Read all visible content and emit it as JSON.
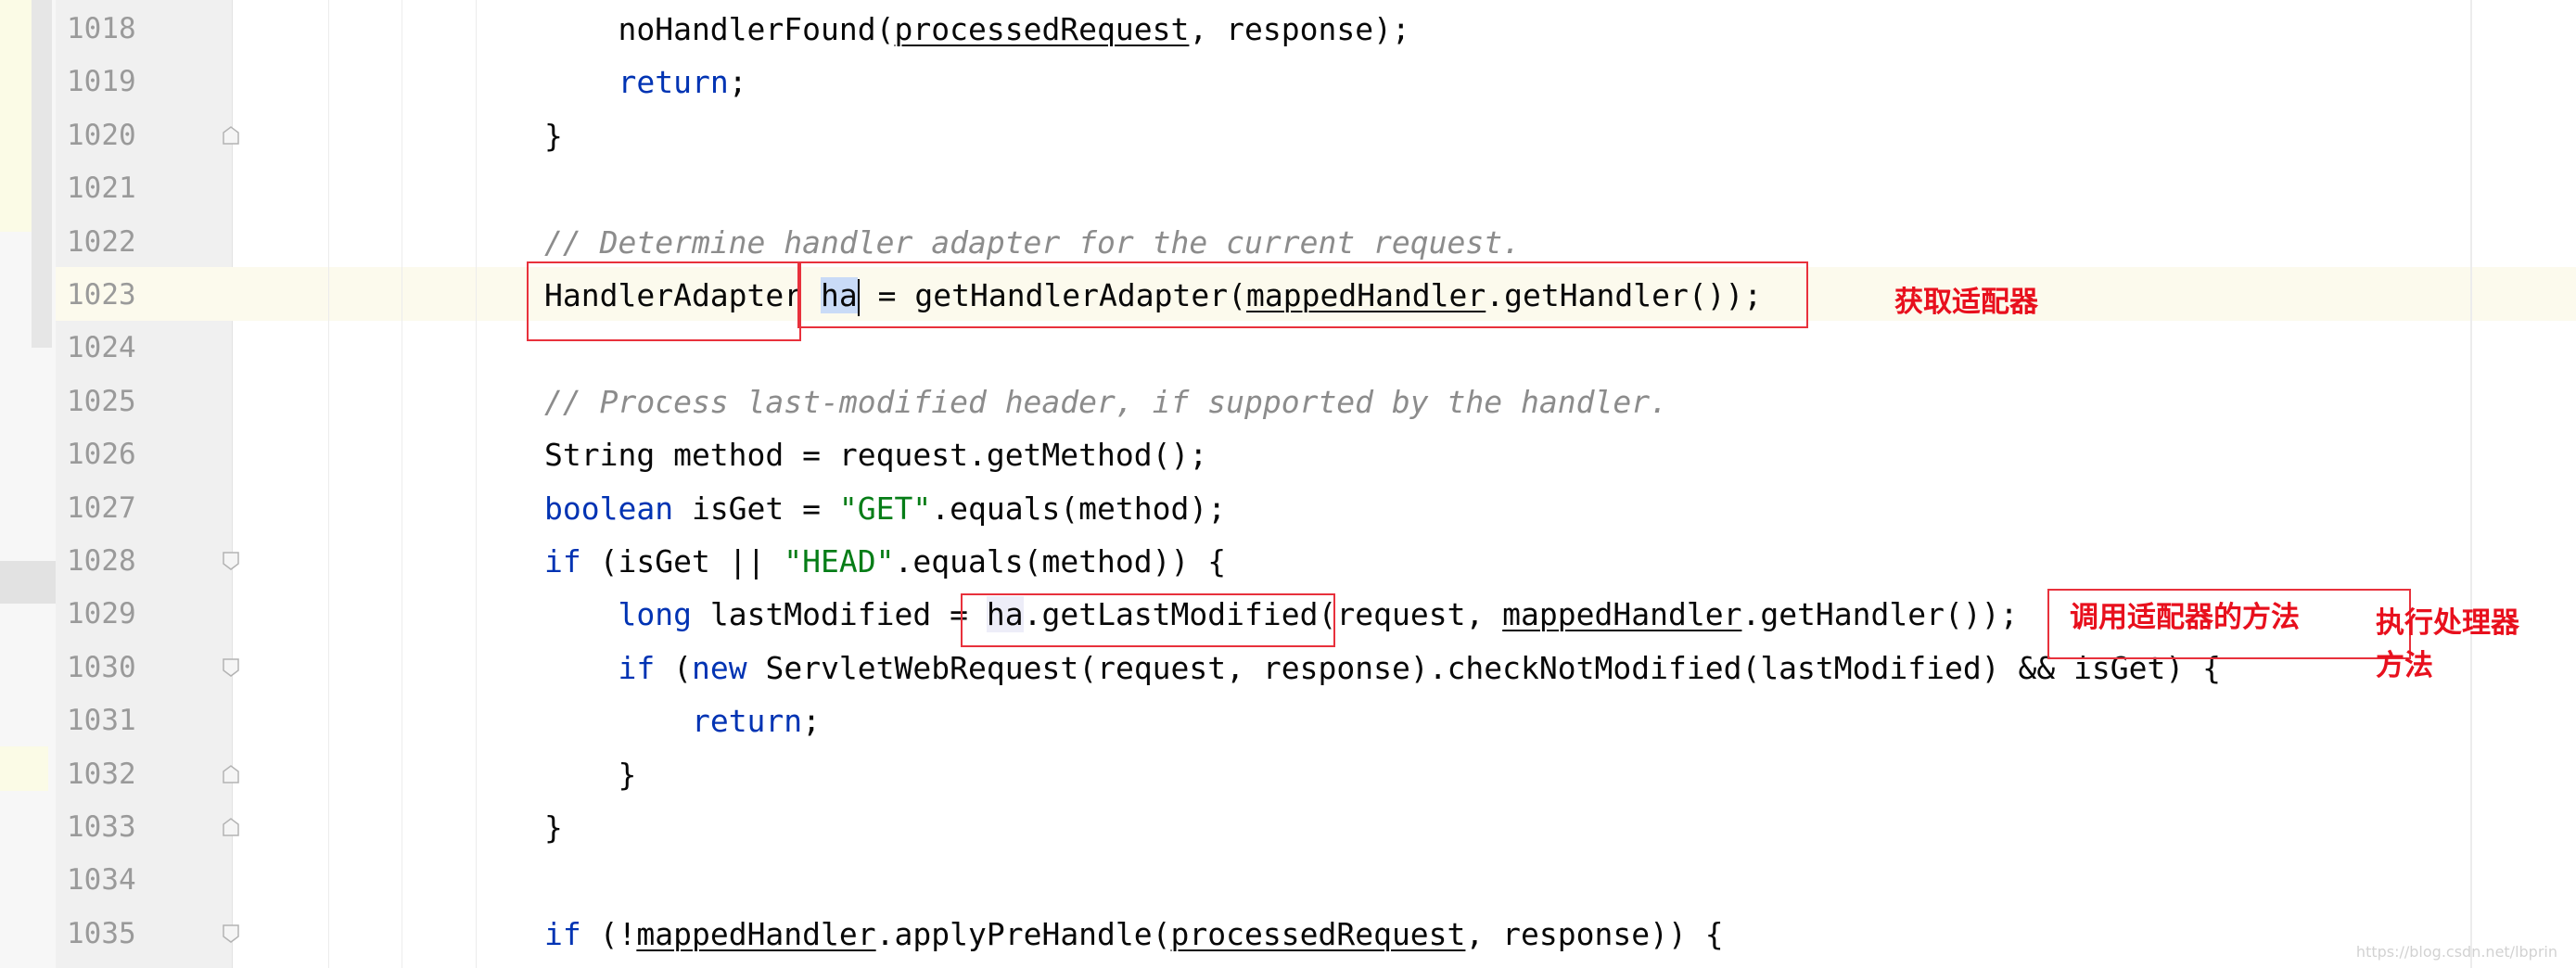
{
  "editor": {
    "lines": [
      {
        "num": "1018",
        "tokens": [
          {
            "text": "    noHandlerFound("
          },
          {
            "text": "processedRequest",
            "cls": "ul"
          },
          {
            "text": ", response);"
          }
        ]
      },
      {
        "num": "1019",
        "tokens": [
          {
            "text": "    "
          },
          {
            "text": "return",
            "cls": "kw"
          },
          {
            "text": ";"
          }
        ]
      },
      {
        "num": "1020",
        "tokens": [
          {
            "text": "}"
          }
        ]
      },
      {
        "num": "1021",
        "tokens": []
      },
      {
        "num": "1022",
        "tokens": [
          {
            "text": "// Determine handler adapter for the current request.",
            "cls": "cm"
          }
        ]
      },
      {
        "num": "1023",
        "tokens": [
          {
            "text": "HandlerAdapter "
          },
          {
            "text": "ha",
            "cls": "sel"
          },
          {
            "caret": true
          },
          {
            "text": " = getHandlerAdapter("
          },
          {
            "text": "mappedHandler",
            "cls": "ul"
          },
          {
            "text": ".getHandler());"
          }
        ]
      },
      {
        "num": "1024",
        "tokens": []
      },
      {
        "num": "1025",
        "tokens": [
          {
            "text": "// Process last-modified header, if supported by the handler.",
            "cls": "cm"
          }
        ]
      },
      {
        "num": "1026",
        "tokens": [
          {
            "text": "String method = request.getMethod();"
          }
        ]
      },
      {
        "num": "1027",
        "tokens": [
          {
            "text": "boolean",
            "cls": "kw"
          },
          {
            "text": " isGet = "
          },
          {
            "text": "\"GET\"",
            "cls": "str"
          },
          {
            "text": ".equals(method);"
          }
        ]
      },
      {
        "num": "1028",
        "tokens": [
          {
            "text": "if",
            "cls": "kw"
          },
          {
            "text": " (isGet || "
          },
          {
            "text": "\"HEAD\"",
            "cls": "str"
          },
          {
            "text": ".equals(method)) {"
          }
        ]
      },
      {
        "num": "1029",
        "tokens": [
          {
            "text": "    "
          },
          {
            "text": "long",
            "cls": "kw"
          },
          {
            "text": " lastModified = "
          },
          {
            "text": "ha",
            "cls": "hl"
          },
          {
            "text": ".getLastModified(request, "
          },
          {
            "text": "mappedHandler",
            "cls": "ul"
          },
          {
            "text": ".getHandler());"
          }
        ]
      },
      {
        "num": "1030",
        "tokens": [
          {
            "text": "    "
          },
          {
            "text": "if",
            "cls": "kw"
          },
          {
            "text": " ("
          },
          {
            "text": "new",
            "cls": "kw"
          },
          {
            "text": " ServletWebRequest(request, response).checkNotModified(lastModified) && isGet) {"
          }
        ]
      },
      {
        "num": "1031",
        "tokens": [
          {
            "text": "        "
          },
          {
            "text": "return",
            "cls": "kw"
          },
          {
            "text": ";"
          }
        ]
      },
      {
        "num": "1032",
        "tokens": [
          {
            "text": "    }"
          }
        ]
      },
      {
        "num": "1033",
        "tokens": [
          {
            "text": "}"
          }
        ]
      },
      {
        "num": "1034",
        "tokens": []
      },
      {
        "num": "1035",
        "tokens": [
          {
            "text": "if",
            "cls": "kw"
          },
          {
            "text": " (!"
          },
          {
            "text": "mappedHandler",
            "cls": "ul"
          },
          {
            "text": ".applyPreHandle("
          },
          {
            "text": "processedRequest",
            "cls": "ul"
          },
          {
            "text": ", response)) {"
          }
        ]
      }
    ]
  },
  "annotations": {
    "get_adapter": "获取适配器",
    "call_adapter": "调用适配器的方法",
    "exec_handler_line1": "执行处理器",
    "exec_handler_line2": "方法"
  },
  "watermark": "https://blog.csdn.net/lbprin",
  "colors": {
    "keyword": "#0033b3",
    "string": "#067d17",
    "comment": "#8c8c8c",
    "annotation_red": "#e8101d",
    "selection": "#c9dbf7"
  }
}
